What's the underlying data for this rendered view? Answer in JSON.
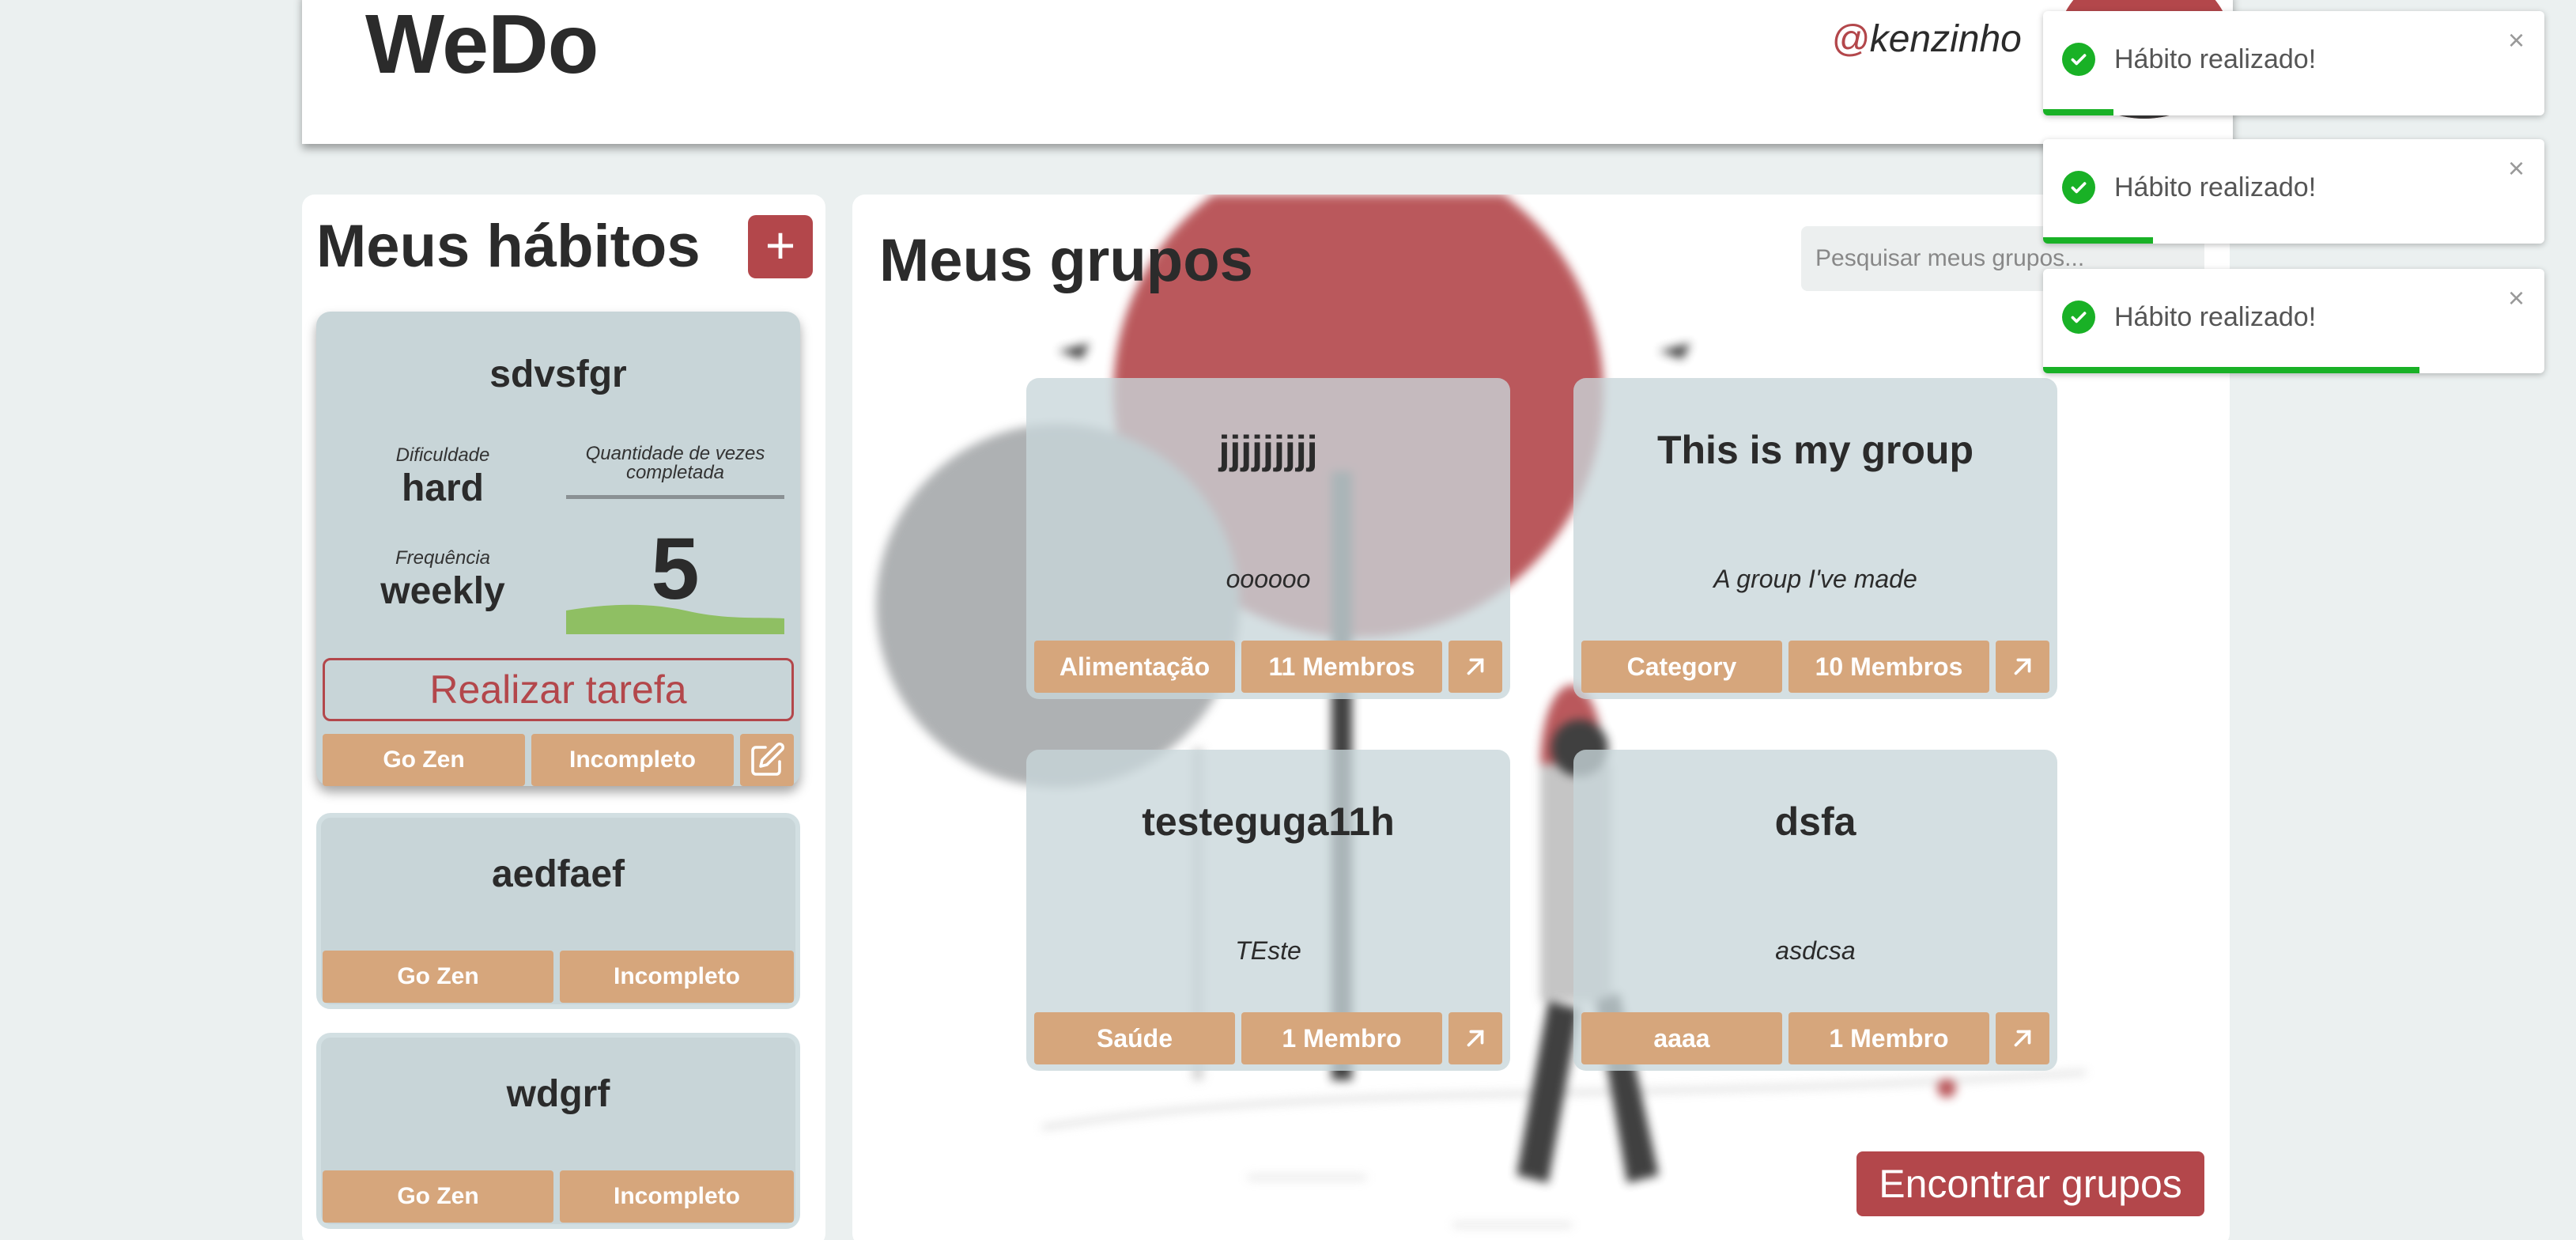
{
  "header": {
    "logo": "WeDo",
    "username_at": "@",
    "username": "kenzinho"
  },
  "habits": {
    "title": "Meus hábitos",
    "add_label": "+",
    "main": {
      "name": "sdvsfgr",
      "difficulty_label": "Dificuldade",
      "difficulty": "hard",
      "frequency_label": "Frequência",
      "frequency": "weekly",
      "count_label": "Quantidade de vezes completada",
      "count": "5",
      "do_label": "Realizar tarefa",
      "category": "Go Zen",
      "status": "Incompleto"
    },
    "items": [
      {
        "name": "aedfaef",
        "category": "Go Zen",
        "status": "Incompleto"
      },
      {
        "name": "wdgrf",
        "category": "Go Zen",
        "status": "Incompleto"
      }
    ]
  },
  "groups": {
    "title": "Meus grupos",
    "search_placeholder": "Pesquisar meus grupos...",
    "find_label": "Encontrar grupos",
    "cards": [
      {
        "name": "jjjjjjjjj",
        "description": "oooooo",
        "category": "Alimentação",
        "members": "11 Membros"
      },
      {
        "name": "This is my group",
        "description": "A group I've made",
        "category": "Category",
        "members": "10 Membros"
      },
      {
        "name": "testeguga11h",
        "description": "TEste",
        "category": "Saúde",
        "members": "1 Membro"
      },
      {
        "name": "dsfa",
        "description": "asdcsa",
        "category": "aaaa",
        "members": "1 Membro"
      }
    ]
  },
  "toasts": [
    {
      "message": "Hábito realizado!",
      "close": "×",
      "progress": 0.14
    },
    {
      "message": "Hábito realizado!",
      "close": "×",
      "progress": 0.22
    },
    {
      "message": "Hábito realizado!",
      "close": "×",
      "progress": 0.75
    }
  ],
  "colors": {
    "accent": "#b3474b",
    "tag": "#d6a67c",
    "card": "#c8d5d8",
    "success": "#19b126"
  }
}
